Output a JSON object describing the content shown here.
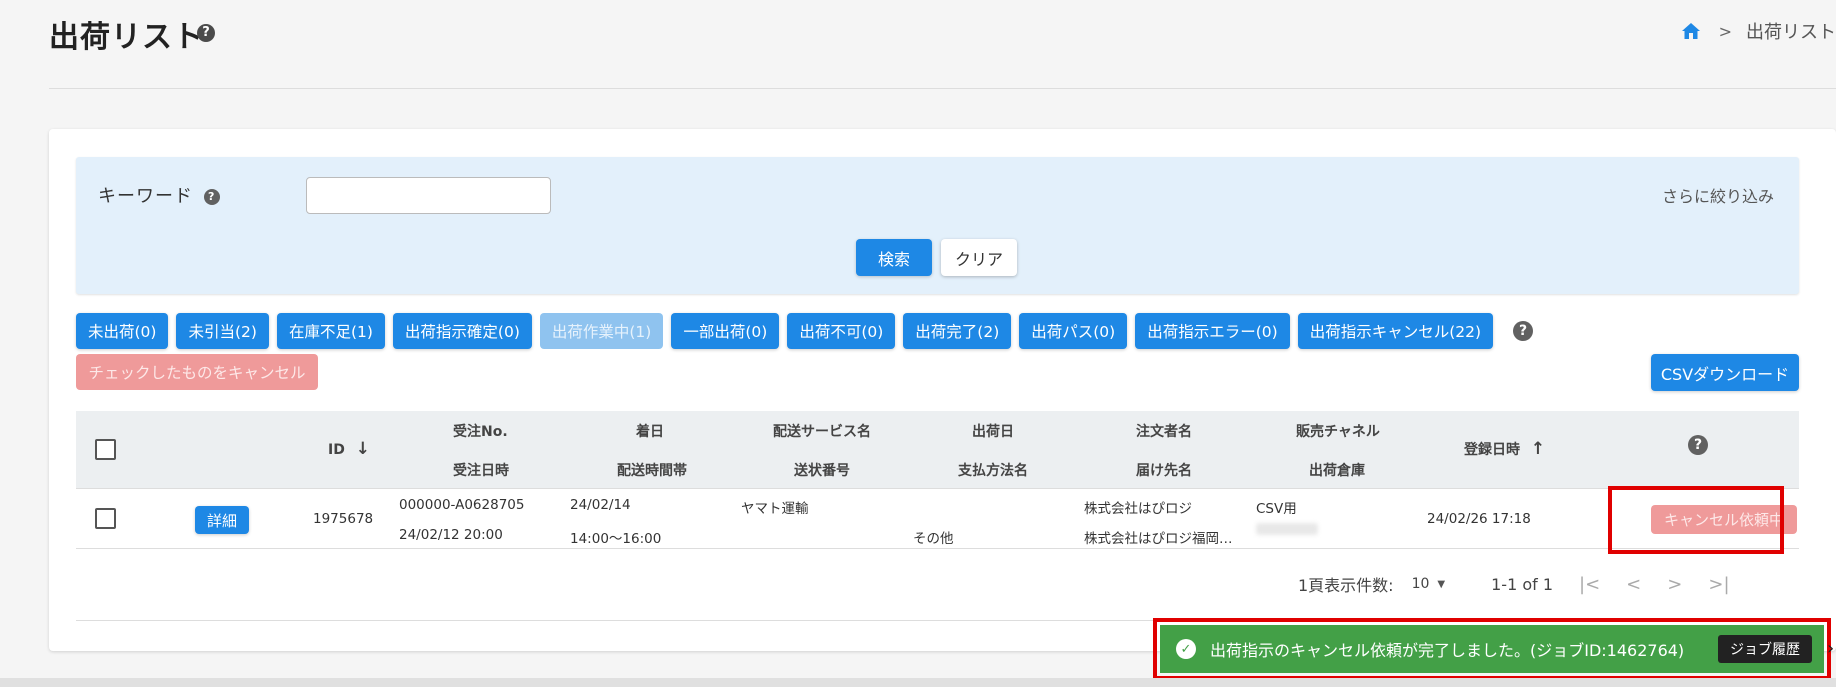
{
  "header": {
    "title": "出荷リスト",
    "help_icon": "?",
    "breadcrumb": {
      "home_icon": "home-icon",
      "separator": ">",
      "current": "出荷リスト"
    }
  },
  "search": {
    "keyword_label": "キーワード",
    "keyword_value": "",
    "filter_more": "さらに絞り込み",
    "search_button": "検索",
    "clear_button": "クリア"
  },
  "status_filters": [
    {
      "label": "未出荷(0)",
      "state": "enabled"
    },
    {
      "label": "未引当(2)",
      "state": "enabled"
    },
    {
      "label": "在庫不足(1)",
      "state": "enabled"
    },
    {
      "label": "出荷指示確定(0)",
      "state": "enabled"
    },
    {
      "label": "出荷作業中(1)",
      "state": "disabled"
    },
    {
      "label": "一部出荷(0)",
      "state": "enabled"
    },
    {
      "label": "出荷不可(0)",
      "state": "enabled"
    },
    {
      "label": "出荷完了(2)",
      "state": "enabled"
    },
    {
      "label": "出荷パス(0)",
      "state": "enabled"
    },
    {
      "label": "出荷指示エラー(0)",
      "state": "enabled"
    },
    {
      "label": "出荷指示キャンセル(22)",
      "state": "enabled"
    }
  ],
  "actions": {
    "cancel_checked": "チェックしたものをキャンセル",
    "csv_download": "CSVダウンロード"
  },
  "table": {
    "headers": {
      "id": "ID",
      "order_no": "受注No.",
      "order_date": "受注日時",
      "arrival_date": "着日",
      "delivery_time": "配送時間帯",
      "delivery_service": "配送サービス名",
      "tracking_no": "送状番号",
      "ship_date": "出荷日",
      "payment_method": "支払方法名",
      "orderer": "注文者名",
      "recipient": "届け先名",
      "sales_channel": "販売チャネル",
      "warehouse": "出荷倉庫",
      "registered_at": "登録日時"
    },
    "rows": [
      {
        "detail_label": "詳細",
        "id": "1975678",
        "order_no": "000000-A0628705",
        "order_date": "24/02/12 20:00",
        "arrival_date": "24/02/14",
        "delivery_time": "14:00～16:00",
        "delivery_service": "ヤマト運輸",
        "tracking_no": "",
        "ship_date": "",
        "payment_method": "その他",
        "orderer": "株式会社はぴロジ",
        "recipient": "株式会社はぴロジ福岡…",
        "sales_channel": "CSV用",
        "registered_at": "24/02/26 17:18",
        "status_button": "キャンセル依頼中"
      }
    ]
  },
  "pagination": {
    "per_page_label": "1頁表示件数:",
    "per_page_value": "10",
    "range": "1-1 of 1"
  },
  "toast": {
    "message": "出荷指示のキャンセル依頼が完了しました。(ジョブID:1462764)",
    "job_history_button": "ジョブ履歴"
  },
  "colors": {
    "primary": "#1e88e5",
    "disabled_primary": "#8fc3ef",
    "danger_disabled": "#ef9a9a",
    "success": "#43a047",
    "highlight_box": "#e00000",
    "search_panel": "#e3f0fb"
  }
}
